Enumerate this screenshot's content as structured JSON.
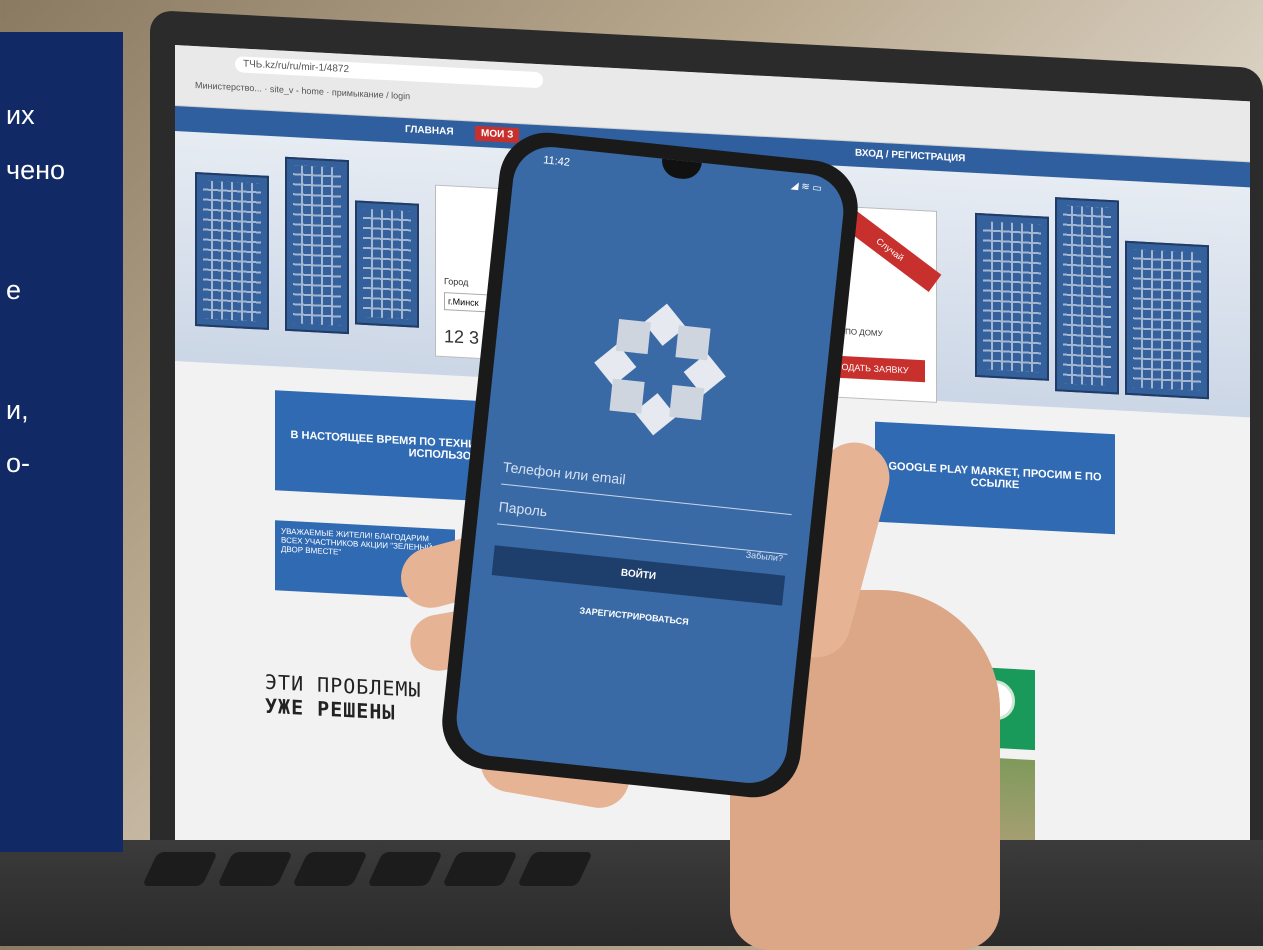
{
  "overlay": {
    "lines": [
      "их",
      "чено",
      "е",
      "и,",
      "о-"
    ]
  },
  "browser": {
    "address": "ТЧЬ.kz/ru/ru/mir-1/4872",
    "bookmarks": "Министерство...  ·  site_v - home  ·  примыкание / login",
    "nav": {
      "home": "ГЛАВНАЯ",
      "my": "МОИ З",
      "login": "ВХОД / РЕГИСТРАЦИЯ"
    },
    "card": {
      "city_label": "Город",
      "city": "г.Минск",
      "count": "12 3"
    },
    "ribbon": "Случай",
    "red_button": "ОДАТЬ ЗАЯВКУ",
    "right_text": "НИЕ ПО ДОМУ",
    "banner_left": "В НАСТОЯЩЕЕ ВРЕМЯ ПО ТЕХНИЧЕСКИМ ВРЕМЕННО ИСПОЛЬЗО",
    "banner_right": "GOOGLE PLAY MARKET, ПРОСИМ Е ПО ССЫЛКЕ",
    "notice": "УВАЖАЕМЫЕ ЖИТЕЛИ! БЛАГОДАРИМ ВСЕХ УЧАСТНИКОВ АКЦИИ \"ЗЕЛЕНЫЙ ДВОР ВМЕСТЕ\"",
    "problems_line1": "ЭТИ ПРОБЛЕМЫ",
    "problems_line2": "УЖЕ РЕШЕНЫ",
    "stars": "★★★★★"
  },
  "phone": {
    "time": "11:42",
    "status": "◢ ≋ ▭",
    "login_placeholder": "Телефон или email",
    "password_placeholder": "Пароль",
    "forgot": "Забыли?",
    "login_button": "ВОЙТИ",
    "register_button": "ЗАРЕГИСТРИРОВАТЬСЯ"
  },
  "colors": {
    "overlay_bg": "#112a66",
    "phone_bg": "#3a6aa6",
    "site_blue": "#2f6ab3",
    "site_red": "#c7302d",
    "site_green": "#1a9a5a"
  }
}
